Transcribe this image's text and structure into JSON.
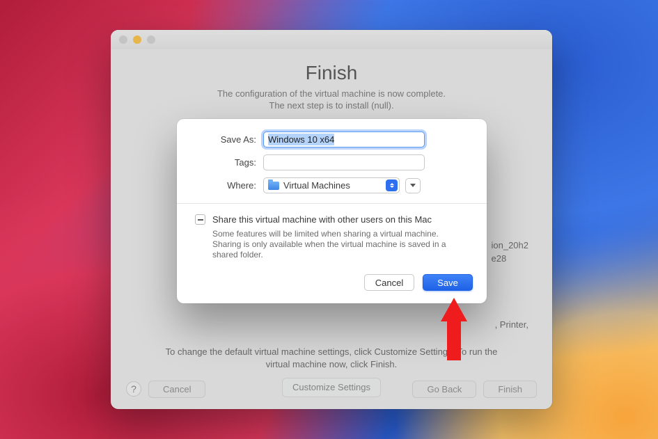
{
  "window": {
    "title": "Finish",
    "subtitle1": "The configuration of the virtual machine is now complete.",
    "subtitle2": "The next step is to install (null).",
    "bg_detail_1": "ion_20h2",
    "bg_detail_2": "e28",
    "bg_detail_3": ", Printer,",
    "hint_line1": "To change the default virtual machine settings, click Customize Settings. To run the",
    "hint_line2": "virtual machine now, click Finish.",
    "customize_label": "Customize Settings",
    "help_label": "?",
    "cancel_label": "Cancel",
    "goback_label": "Go Back",
    "finish_label": "Finish"
  },
  "sheet": {
    "saveas_label": "Save As:",
    "saveas_value": "Windows 10 x64",
    "tags_label": "Tags:",
    "tags_value": "",
    "where_label": "Where:",
    "where_value": "Virtual Machines",
    "share_label": "Share this virtual machine with other users on this Mac",
    "share_note": "Some features will be limited when sharing a virtual machine. Sharing is only available when the virtual machine is saved in a shared folder.",
    "cancel_label": "Cancel",
    "save_label": "Save"
  }
}
